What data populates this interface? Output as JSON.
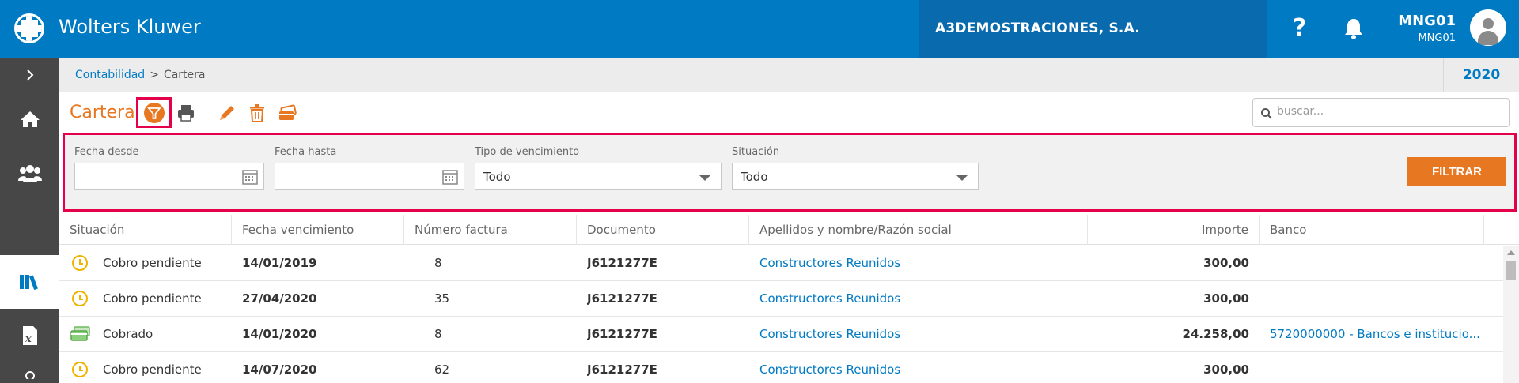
{
  "header": {
    "brand": "Wolters Kluwer",
    "company": "A3DEMOSTRACIONES, S.A.",
    "help_label": "?",
    "user_name": "MNG01",
    "user_sub": "MNG01"
  },
  "breadcrumb": {
    "root": "Contabilidad",
    "separator": ">",
    "current": "Cartera",
    "year": "2020"
  },
  "toolbar": {
    "title": "Cartera",
    "search_placeholder": "buscar..."
  },
  "filters": {
    "fecha_desde_label": "Fecha desde",
    "fecha_desde_value": "",
    "fecha_hasta_label": "Fecha hasta",
    "fecha_hasta_value": "",
    "tipo_label": "Tipo de vencimiento",
    "tipo_value": "Todo",
    "situacion_label": "Situación",
    "situacion_value": "Todo",
    "filtrar_label": "FILTRAR"
  },
  "table": {
    "columns": [
      "Situación",
      "Fecha vencimiento",
      "Número factura",
      "Documento",
      "Apellidos y nombre/Razón social",
      "Importe",
      "Banco"
    ],
    "rows": [
      {
        "status_icon": "clock-icon",
        "situacion": "Cobro pendiente",
        "fecha": "14/01/2019",
        "factura": "8",
        "documento": "J6121277E",
        "razon": "Constructores Reunidos",
        "importe": "300,00",
        "banco": ""
      },
      {
        "status_icon": "clock-icon",
        "situacion": "Cobro pendiente",
        "fecha": "27/04/2020",
        "factura": "35",
        "documento": "J6121277E",
        "razon": "Constructores Reunidos",
        "importe": "300,00",
        "banco": ""
      },
      {
        "status_icon": "money-icon",
        "situacion": "Cobrado",
        "fecha": "14/01/2020",
        "factura": "8",
        "documento": "J6121277E",
        "razon": "Constructores Reunidos",
        "importe": "24.258,00",
        "banco": "5720000000 - Bancos e institucio..."
      },
      {
        "status_icon": "clock-icon",
        "situacion": "Cobro pendiente",
        "fecha": "14/07/2020",
        "factura": "62",
        "documento": "J6121277E",
        "razon": "Constructores Reunidos",
        "importe": "300,00",
        "banco": ""
      }
    ]
  },
  "colors": {
    "header_blue": "#007ac3",
    "accent_orange": "#e87722",
    "highlight_red": "#e5004c",
    "sidebar_dark": "#474747"
  }
}
